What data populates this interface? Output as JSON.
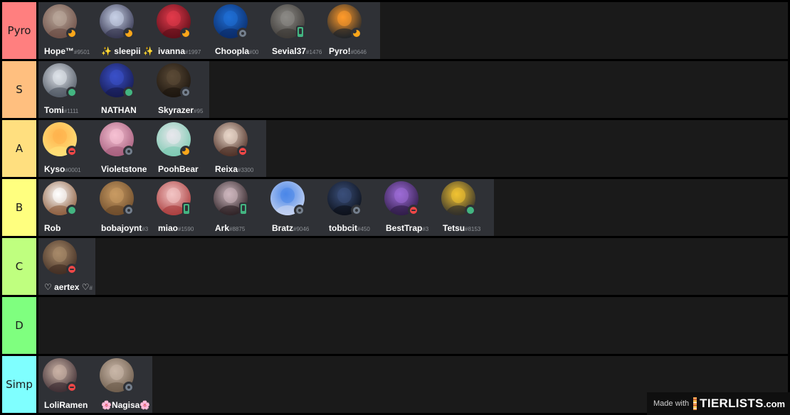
{
  "tiers": [
    {
      "label": "Pyro",
      "color": "#ff7f7f",
      "items": [
        {
          "name": "Hope™",
          "tag": "#9501",
          "status": "idle",
          "palette": [
            "#b9a79a",
            "#6b4d45"
          ]
        },
        {
          "name": "✨ sleepii ✨",
          "tag": "",
          "status": "idle",
          "palette": [
            "#c7d0e6",
            "#30304a"
          ]
        },
        {
          "name": "ivanna",
          "tag": "#1997",
          "status": "idle",
          "palette": [
            "#e23a4b",
            "#5a0d18"
          ]
        },
        {
          "name": "Choopla",
          "tag": "#00",
          "status": "offline",
          "palette": [
            "#1f6fd6",
            "#0a2a66"
          ]
        },
        {
          "name": "Sevial37",
          "tag": "#1476",
          "status": "mobile",
          "palette": [
            "#8c8a86",
            "#3a3734"
          ]
        },
        {
          "name": "Pyro!",
          "tag": "#0646",
          "status": "idle",
          "palette": [
            "#ff9a2a",
            "#17202a"
          ]
        }
      ]
    },
    {
      "label": "S",
      "color": "#ffbf7f",
      "items": [
        {
          "name": "Tomi",
          "tag": "#1111",
          "status": "online",
          "palette": [
            "#dfe3ea",
            "#4d5560"
          ]
        },
        {
          "name": "NATHAN",
          "tag": "",
          "status": "online",
          "palette": [
            "#3a50c9",
            "#15194b"
          ]
        },
        {
          "name": "Skyrazer",
          "tag": "#95",
          "status": "offline",
          "palette": [
            "#5b4a36",
            "#1a140e"
          ]
        }
      ]
    },
    {
      "label": "A",
      "color": "#ffdf7f",
      "items": [
        {
          "name": "Kyso",
          "tag": "#0001",
          "status": "dnd",
          "palette": [
            "#ffb24d",
            "#ffe27a"
          ]
        },
        {
          "name": "Violetstone",
          "tag": "",
          "status": "offline",
          "palette": [
            "#f6c1d3",
            "#a35b7a"
          ]
        },
        {
          "name": "PoohBear",
          "tag": "",
          "status": "idle",
          "palette": [
            "#e8e7ec",
            "#7ac8b0"
          ]
        },
        {
          "name": "Reixa",
          "tag": "#3300",
          "status": "dnd",
          "palette": [
            "#e8d6c8",
            "#4a2b22"
          ]
        }
      ]
    },
    {
      "label": "B",
      "color": "#ffff7f",
      "items": [
        {
          "name": "Rob",
          "tag": "",
          "status": "online",
          "palette": [
            "#ffffff",
            "#8a5a3a"
          ]
        },
        {
          "name": "bobajoynt",
          "tag": "#3",
          "status": "offline",
          "palette": [
            "#c99b63",
            "#6b4a2a"
          ]
        },
        {
          "name": "miao",
          "tag": "#1590",
          "status": "mobile",
          "palette": [
            "#f2c4c4",
            "#a83a3a"
          ]
        },
        {
          "name": "Ark",
          "tag": "#8875",
          "status": "mobile",
          "palette": [
            "#cdb7be",
            "#2a1e22"
          ]
        },
        {
          "name": "Bratz",
          "tag": "#9046",
          "status": "offline",
          "palette": [
            "#4a86e8",
            "#c9d6f2"
          ]
        },
        {
          "name": "tobbcit",
          "tag": "#450",
          "status": "offline",
          "palette": [
            "#3a4f7a",
            "#0b0f18"
          ]
        },
        {
          "name": "BestTrap",
          "tag": "#3",
          "status": "dnd",
          "palette": [
            "#9c6bd6",
            "#2d1a45"
          ]
        },
        {
          "name": "Tetsu",
          "tag": "#8153",
          "status": "online",
          "palette": [
            "#f1c232",
            "#2a2a2a"
          ]
        }
      ]
    },
    {
      "label": "C",
      "color": "#bfff7f",
      "items": [
        {
          "name": "♡ aertex ♡",
          "tag": "#",
          "status": "dnd",
          "palette": [
            "#a88a6a",
            "#3f2c22"
          ]
        }
      ]
    },
    {
      "label": "D",
      "color": "#7fff7f",
      "items": []
    },
    {
      "label": "Simp",
      "color": "#7fffff",
      "items": [
        {
          "name": "LoliRamen",
          "tag": "",
          "status": "dnd",
          "palette": [
            "#cbb3a6",
            "#3a2a30"
          ]
        },
        {
          "name": "🌸Nagisa🌸",
          "tag": "",
          "status": "offline",
          "palette": [
            "#c9b7a8",
            "#6b5a4a"
          ]
        }
      ]
    }
  ],
  "watermark": {
    "made_with": "Made with",
    "brand": "TIERLISTS",
    "brand_suffix": ".com"
  }
}
